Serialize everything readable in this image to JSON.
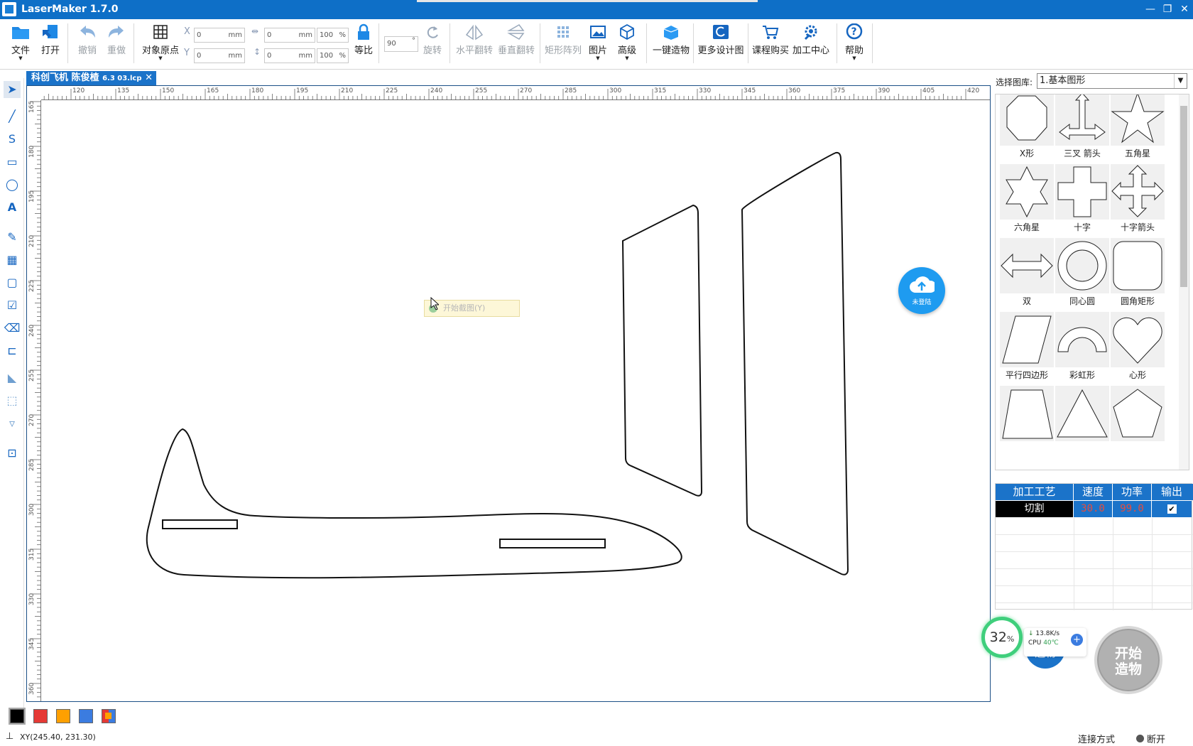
{
  "window": {
    "title": "LaserMaker 1.7.0"
  },
  "toolbar": {
    "file": "文件",
    "open": "打开",
    "undo": "撤销",
    "redo": "重做",
    "origin": "对象原点",
    "ratio": "等比",
    "rotate": "旋转",
    "hflip": "水平翻转",
    "vflip": "垂直翻转",
    "array": "矩形阵列",
    "image": "图片",
    "advanced": "高级",
    "oneclick": "一键造物",
    "more_designs": "更多设计图",
    "course_buy": "课程购买",
    "process_center": "加工中心",
    "help": "帮助",
    "x_value": "0",
    "y_value": "0",
    "w_value": "0",
    "h_value": "0",
    "w_pct": "100",
    "h_pct": "100",
    "unit": "mm",
    "pct": "%",
    "angle": "90",
    "deg": "°",
    "x_label": "X",
    "y_label": "Y"
  },
  "tab": {
    "name": "科创飞机 陈俊楂",
    "suffix": "6.3 03.lcp",
    "close": "✕"
  },
  "ruler": {
    "h_ticks": [
      "120",
      "135",
      "150",
      "165",
      "180",
      "195",
      "210",
      "225",
      "240",
      "255",
      "270",
      "285",
      "300",
      "315",
      "330",
      "345",
      "360",
      "375",
      "390",
      "405",
      "420"
    ],
    "v_ticks": [
      "165",
      "180",
      "195",
      "210",
      "225",
      "240",
      "255",
      "270",
      "285",
      "300",
      "315",
      "330",
      "345",
      "360"
    ]
  },
  "cloud": {
    "label": "未登陆"
  },
  "snip": {
    "text": "开始截图(Y)"
  },
  "library": {
    "label": "选择图库:",
    "selected": "1.基本图形"
  },
  "shapes": [
    {
      "name": "X形",
      "icon": "octagon-x-shape-icon"
    },
    {
      "name": "三叉 箭头",
      "icon": "three-way-arrow-icon"
    },
    {
      "name": "五角星",
      "icon": "five-star-icon"
    },
    {
      "name": "六角星",
      "icon": "six-star-icon"
    },
    {
      "name": "十字",
      "icon": "cross-icon"
    },
    {
      "name": "十字箭头",
      "icon": "cross-arrow-icon"
    },
    {
      "name": "双",
      "icon": "double-arrow-icon"
    },
    {
      "name": "同心圆",
      "icon": "concentric-circle-icon"
    },
    {
      "name": "圆角矩形",
      "icon": "rounded-rect-icon"
    },
    {
      "name": "平行四边形",
      "icon": "parallelogram-icon"
    },
    {
      "name": "彩虹形",
      "icon": "rainbow-icon"
    },
    {
      "name": "心形",
      "icon": "heart-icon"
    },
    {
      "name": "",
      "icon": "trapezoid-icon"
    },
    {
      "name": "",
      "icon": "triangle-icon"
    },
    {
      "name": "",
      "icon": "pentagon-icon"
    }
  ],
  "process": {
    "headers": [
      "加工工艺",
      "速度",
      "功率",
      "输出"
    ],
    "row": {
      "mode": "切割",
      "speed": "30.0",
      "power": "99.0",
      "output": "✔"
    }
  },
  "monitor": {
    "percent": "32",
    "pct_sign": "%",
    "net": "13.8K/s",
    "cpu_label": "CPU",
    "cpu_temp": "40℃",
    "hidden_btn": "造物"
  },
  "start": {
    "line1": "开始",
    "line2": "造物"
  },
  "palette": [
    "#000000",
    "#e53935",
    "#ffa000",
    "#3b7ce0",
    "multi"
  ],
  "status": {
    "coord": "XY(245.40, 231.30)",
    "conn": "连接方式",
    "state": "断开"
  }
}
